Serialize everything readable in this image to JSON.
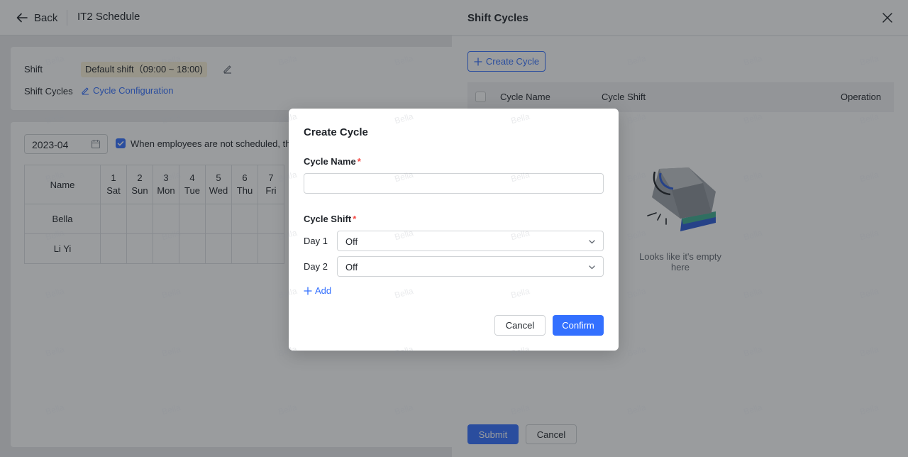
{
  "header": {
    "back_label": "Back",
    "title": "IT2 Schedule"
  },
  "shift_section": {
    "shift_label": "Shift",
    "default_shift": "Default shift（09:00 ~ 18:00)",
    "cycles_label": "Shift Cycles",
    "cycle_config_link": "Cycle Configuration"
  },
  "schedule": {
    "month": "2023-04",
    "checkbox_label": "When employees are not scheduled, the",
    "name_header": "Name",
    "days": [
      {
        "num": "1",
        "dow": "Sat"
      },
      {
        "num": "2",
        "dow": "Sun"
      },
      {
        "num": "3",
        "dow": "Mon"
      },
      {
        "num": "4",
        "dow": "Tue"
      },
      {
        "num": "5",
        "dow": "Wed"
      },
      {
        "num": "6",
        "dow": "Thu"
      },
      {
        "num": "7",
        "dow": "Fri"
      }
    ],
    "employees": [
      "Bella",
      "Li Yi"
    ]
  },
  "drawer": {
    "title": "Shift Cycles",
    "create_button": "Create Cycle",
    "columns": {
      "name": "Cycle Name",
      "shift": "Cycle Shift",
      "operation": "Operation"
    },
    "empty_text": "Looks like it's empty here",
    "submit_label": "Submit",
    "cancel_label": "Cancel"
  },
  "modal": {
    "title": "Create Cycle",
    "cycle_name_label": "Cycle Name",
    "required_mark": "*",
    "cycle_name_value": "",
    "cycle_shift_label": "Cycle Shift",
    "days": [
      {
        "label": "Day 1",
        "value": "Off"
      },
      {
        "label": "Day 2",
        "value": "Off"
      }
    ],
    "add_label": "Add",
    "cancel_label": "Cancel",
    "confirm_label": "Confirm"
  },
  "watermark_text": "Bella",
  "colors": {
    "primary": "#3370ff",
    "required": "#f54a45",
    "shift_tag_bg": "#fbf3d9",
    "overlay": "rgba(31,35,41,0.45)"
  },
  "icons": [
    "arrow-left-icon",
    "edit-icon",
    "calendar-icon",
    "check-icon",
    "close-icon",
    "plus-icon",
    "chevron-down-icon",
    "empty-box-illustration"
  ]
}
